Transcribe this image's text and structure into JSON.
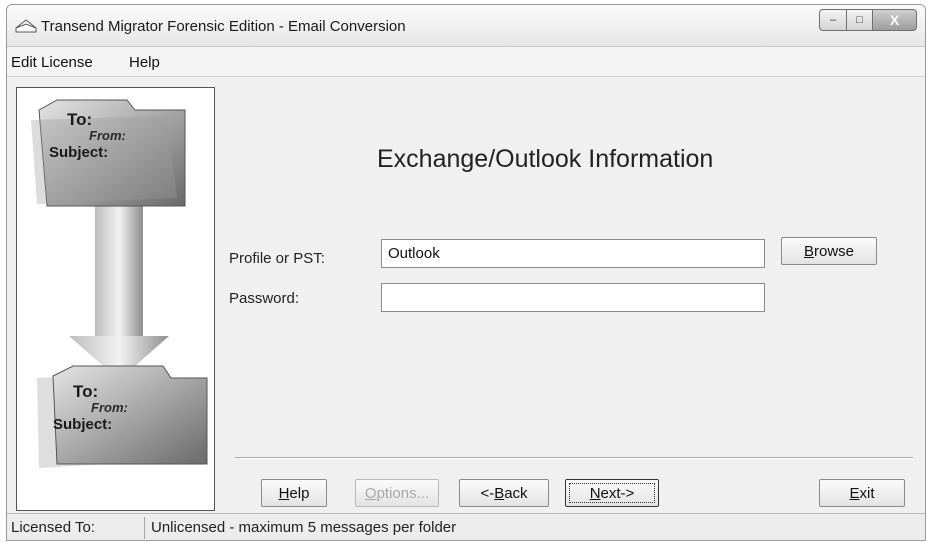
{
  "window": {
    "title": "Transend Migrator Forensic Edition - Email Conversion",
    "controls": {
      "minimize": "–",
      "maximize": "□",
      "close": "X"
    }
  },
  "menu": {
    "items": [
      {
        "label": "Edit License"
      },
      {
        "label": "Help"
      }
    ]
  },
  "illustration": {
    "top_card": {
      "to": "To:",
      "from": "From:",
      "subject": "Subject:"
    },
    "bottom_card": {
      "to": "To:",
      "from": "From:",
      "subject": "Subject:"
    },
    "arrow": "down-arrow-icon"
  },
  "main": {
    "heading": "Exchange/Outlook Information",
    "profile": {
      "label": "Profile or PST:",
      "value": "Outlook"
    },
    "password": {
      "label": "Password:",
      "value": ""
    },
    "browse_button": {
      "label": "Browse",
      "accel": "B",
      "rest": "rowse"
    }
  },
  "buttons": {
    "help": {
      "label": "Help",
      "accel": "H",
      "rest": "elp"
    },
    "options": {
      "label": "Options...",
      "accel": "O",
      "rest": "ptions...",
      "disabled": true
    },
    "back": {
      "label": "<-Back",
      "pre": "<-",
      "accel": "B",
      "rest": "ack"
    },
    "next": {
      "label": "Next->",
      "accel": "N",
      "rest": "ext->",
      "default": true
    },
    "exit": {
      "label": "Exit",
      "accel": "E",
      "rest": "xit"
    }
  },
  "status": {
    "label": "Licensed To:",
    "value": "Unlicensed - maximum 5 messages per folder"
  },
  "colors": {
    "window_bg": "#f0f0f0",
    "border": "#8a8a8a",
    "disabled_text": "#a8a8a8"
  }
}
